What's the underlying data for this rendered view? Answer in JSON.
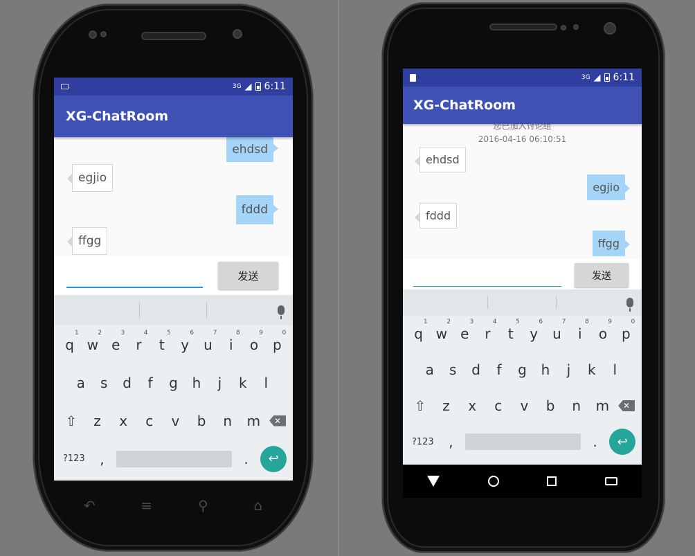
{
  "app_title": "XG-ChatRoom",
  "status": {
    "network": "3G",
    "time": "6:11"
  },
  "phone1": {
    "messages": [
      {
        "side": "me",
        "text": "ehdsd"
      },
      {
        "side": "other",
        "text": "egjio"
      },
      {
        "side": "me",
        "text": "fddd"
      },
      {
        "side": "other",
        "text": "ffgg"
      }
    ],
    "send_label": "发送"
  },
  "phone2": {
    "system_message": "您已加入讨论组",
    "system_time": "2016-04-16 06:10:51",
    "messages": [
      {
        "side": "other",
        "text": "ehdsd"
      },
      {
        "side": "me",
        "text": "egjio"
      },
      {
        "side": "other",
        "text": "fddd"
      },
      {
        "side": "me",
        "text": "ffgg"
      }
    ],
    "send_label": "发送"
  },
  "keyboard": {
    "row1": [
      "q",
      "w",
      "e",
      "r",
      "t",
      "y",
      "u",
      "i",
      "o",
      "p"
    ],
    "row1_nums": [
      "1",
      "2",
      "3",
      "4",
      "5",
      "6",
      "7",
      "8",
      "9",
      "0"
    ],
    "row2": [
      "a",
      "s",
      "d",
      "f",
      "g",
      "h",
      "j",
      "k",
      "l"
    ],
    "row3": [
      "z",
      "x",
      "c",
      "v",
      "b",
      "n",
      "m"
    ],
    "symbols_label": "?123",
    "comma": ",",
    "period": ".",
    "enter_icon": "↩",
    "shift_icon": "⇧",
    "backspace_icon": "✕"
  },
  "colors": {
    "statusbar": "#303f9f",
    "appbar": "#3f51b5",
    "my_bubble": "#a4d4f8",
    "enter_key": "#26a69a",
    "input_underline": "#2196f3"
  }
}
